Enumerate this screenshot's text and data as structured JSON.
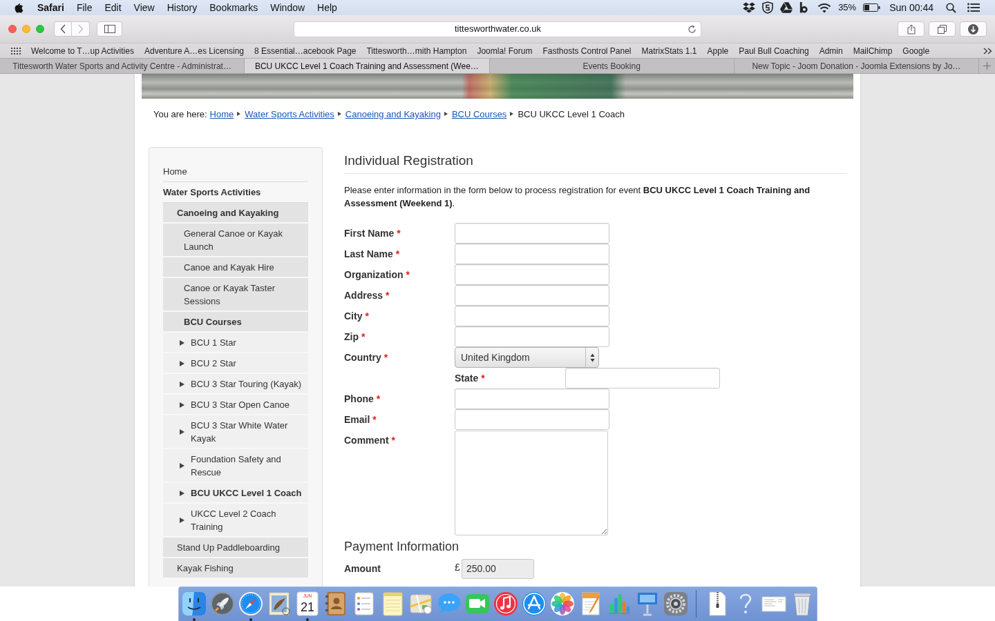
{
  "menu_bar": {
    "app_name": "Safari",
    "menus": [
      "File",
      "Edit",
      "View",
      "History",
      "Bookmarks",
      "Window",
      "Help"
    ],
    "battery_percent": "35%",
    "clock": "Sun 00:44"
  },
  "browser_toolbar": {
    "back_disabled": false,
    "forward_disabled": true,
    "address": "tittesworthwater.co.uk"
  },
  "bookmarks_bar": {
    "items": [
      "Welcome to T…up Activities",
      "Adventure A…es Licensing",
      "8 Essential…acebook Page",
      "Tittesworth…mith Hampton",
      "Joomla! Forum",
      "Fasthosts Control Panel",
      "MatrixStats 1.1",
      "Apple",
      "Paul Bull Coaching",
      "Admin",
      "MailChimp",
      "Google"
    ]
  },
  "tabs": [
    {
      "title": "Tittesworth Water Sports and Activity Centre - Administrat…",
      "selected": false
    },
    {
      "title": "BCU UKCC Level 1 Coach Training and Assessment (Wee…",
      "selected": true
    },
    {
      "title": "Events Booking",
      "selected": false
    },
    {
      "title": "New Topic - Joom Donation - Joomla Extensions by Jo…",
      "selected": false
    }
  ],
  "breadcrumb": {
    "prefix": "You are here:",
    "links": [
      "Home",
      "Water Sports Activities",
      "Canoeing and Kayaking",
      "BCU Courses"
    ],
    "current": "BCU UKCC Level 1 Coach"
  },
  "sidebar": {
    "items": [
      {
        "label": "Home",
        "active": false
      },
      {
        "label": "Water Sports Activities",
        "active": true,
        "children": [
          {
            "label": "Canoeing and Kayaking",
            "active": true,
            "children": [
              {
                "label": "General Canoe or Kayak Launch",
                "active": false
              },
              {
                "label": "Canoe and Kayak Hire",
                "active": false
              },
              {
                "label": "Canoe or Kayak Taster Sessions",
                "active": false
              },
              {
                "label": "BCU Courses",
                "active": true,
                "children": [
                  {
                    "label": "BCU 1 Star",
                    "active": false
                  },
                  {
                    "label": "BCU 2 Star",
                    "active": false
                  },
                  {
                    "label": "BCU 3 Star Touring (Kayak)",
                    "active": false
                  },
                  {
                    "label": "BCU 3 Star Open Canoe",
                    "active": false
                  },
                  {
                    "label": "BCU 3 Star White Water Kayak",
                    "active": false
                  },
                  {
                    "label": "Foundation Safety and Rescue",
                    "active": false
                  },
                  {
                    "label": "BCU UKCC Level 1 Coach",
                    "active": true
                  },
                  {
                    "label": "UKCC Level 2 Coach Training",
                    "active": false
                  }
                ]
              }
            ]
          },
          {
            "label": "Stand Up Paddleboarding",
            "active": false
          },
          {
            "label": "Kayak Fishing",
            "active": false
          }
        ]
      }
    ]
  },
  "registration": {
    "title": "Individual Registration",
    "intro": "Please enter information in the form below to process registration for event **BCU UKCC Level 1 Coach Training and Assessment (Weekend 1)**.",
    "required_mark": "*",
    "fields": [
      {
        "label": "First Name",
        "kind": "text",
        "required": true
      },
      {
        "label": "Last Name",
        "kind": "text",
        "required": true
      },
      {
        "label": "Organization",
        "kind": "text",
        "required": true
      },
      {
        "label": "Address",
        "kind": "text",
        "required": true
      },
      {
        "label": "City",
        "kind": "text",
        "required": true
      },
      {
        "label": "Zip",
        "kind": "text",
        "required": true
      },
      {
        "label": "Country",
        "kind": "select",
        "required": true,
        "value": "United Kingdom"
      },
      {
        "label": "State",
        "kind": "inset_text",
        "required": true
      },
      {
        "label": "Phone",
        "kind": "text",
        "required": true
      },
      {
        "label": "Email",
        "kind": "text",
        "required": true
      },
      {
        "label": "Comment",
        "kind": "textarea",
        "required": true
      }
    ]
  },
  "payment": {
    "title": "Payment Information",
    "fields": [
      {
        "label": "Amount",
        "currency": "£",
        "value": "250.00"
      }
    ]
  },
  "dock": {
    "apps": [
      {
        "kind": "finder",
        "running": true
      },
      {
        "kind": "launchpad",
        "running": false
      },
      {
        "kind": "safari",
        "running": true
      },
      {
        "kind": "mail",
        "running": false
      },
      {
        "kind": "calendar",
        "running": true,
        "month": "JUN",
        "day": "21"
      },
      {
        "kind": "contacts",
        "running": false
      },
      {
        "kind": "reminders",
        "running": false
      },
      {
        "kind": "notes",
        "running": false
      },
      {
        "kind": "maps",
        "running": false
      },
      {
        "kind": "messages",
        "running": false
      },
      {
        "kind": "facetime",
        "running": false
      },
      {
        "kind": "itunes",
        "running": false
      },
      {
        "kind": "app_store",
        "running": false
      },
      {
        "kind": "photos",
        "running": false
      },
      {
        "kind": "pages",
        "running": false
      },
      {
        "kind": "numbers",
        "running": false
      },
      {
        "kind": "keynote",
        "running": false
      },
      {
        "kind": "system_preferences",
        "running": false
      }
    ],
    "documents": [
      {
        "kind": "archive"
      },
      {
        "kind": "help"
      },
      {
        "kind": "document"
      },
      {
        "kind": "trash"
      }
    ]
  }
}
